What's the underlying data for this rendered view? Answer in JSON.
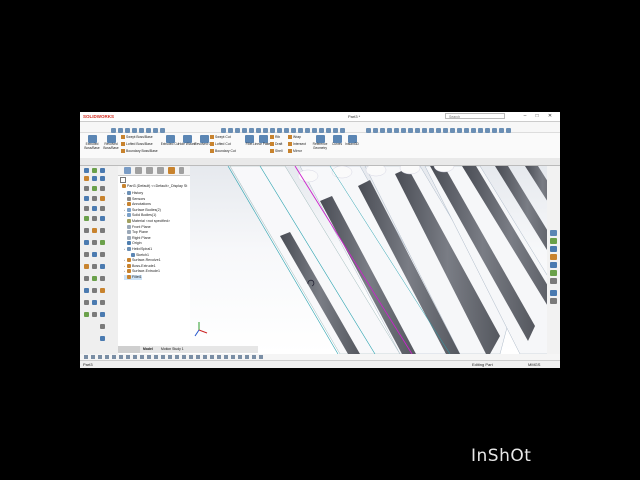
{
  "app": {
    "title": "Part3 *",
    "logo": "SOLIDWORKS",
    "search_placeholder": "Search"
  },
  "ribbon": {
    "big_buttons": [
      {
        "label": "Extruded Boss/Base"
      },
      {
        "label": "Revolved Boss/Base"
      },
      {
        "label": "Extruded Cut"
      },
      {
        "label": "Hole Wizard"
      },
      {
        "label": "Revolved Cut"
      },
      {
        "label": "Fillet"
      },
      {
        "label": "Linear Pattern"
      },
      {
        "label": "Reference Geometry"
      },
      {
        "label": "Curves"
      },
      {
        "label": "Instant3D"
      }
    ],
    "small_buttons": [
      {
        "label": "Swept Boss/Base"
      },
      {
        "label": "Lofted Boss/Base"
      },
      {
        "label": "Boundary Boss/Base"
      },
      {
        "label": "Swept Cut"
      },
      {
        "label": "Lofted Cut"
      },
      {
        "label": "Boundary Cut"
      },
      {
        "label": "Rib"
      },
      {
        "label": "Draft"
      },
      {
        "label": "Shell"
      },
      {
        "label": "Wrap"
      },
      {
        "label": "Intersect"
      },
      {
        "label": "Mirror"
      }
    ]
  },
  "tabs": [
    "Features",
    "Sketch",
    "Surfaces",
    "Sheet Metal",
    "Structure System",
    "Weld Tools",
    "Mesh Modeling",
    "Direct Editing",
    "Evaluate",
    "MBD Dimensions",
    "SOLIDWORKS Add-Ins"
  ],
  "feature_tree": {
    "root": "Part3 (Default) <<Default>_Display St",
    "items": [
      {
        "label": "History",
        "indent": 1,
        "expander": true,
        "color": "#6b8fb5"
      },
      {
        "label": "Sensors",
        "indent": 1,
        "expander": false,
        "color": "#8a8a8a"
      },
      {
        "label": "Annotations",
        "indent": 1,
        "expander": true,
        "color": "#c8832e"
      },
      {
        "label": "Surface Bodies(2)",
        "indent": 1,
        "expander": true,
        "color": "#7aa0c8"
      },
      {
        "label": "Solid Bodies(1)",
        "indent": 1,
        "expander": true,
        "color": "#7aa0c8"
      },
      {
        "label": "Material <not specified>",
        "indent": 1,
        "expander": false,
        "color": "#a0a060"
      },
      {
        "label": "Front Plane",
        "indent": 1,
        "expander": false,
        "color": "#9aa8b8"
      },
      {
        "label": "Top Plane",
        "indent": 1,
        "expander": false,
        "color": "#9aa8b8"
      },
      {
        "label": "Right Plane",
        "indent": 1,
        "expander": false,
        "color": "#9aa8b8"
      },
      {
        "label": "Origin",
        "indent": 1,
        "expander": false,
        "color": "#4f7fb0"
      },
      {
        "label": "Helix/Spiral1",
        "indent": 1,
        "expander": true,
        "color": "#6b8fb5"
      },
      {
        "label": "Sketch1",
        "indent": 2,
        "expander": false,
        "color": "#5b86b4"
      },
      {
        "label": "Surface-Revolve1",
        "indent": 1,
        "expander": true,
        "color": "#c8832e"
      },
      {
        "label": "Boss-Extrude1",
        "indent": 1,
        "expander": true,
        "color": "#c8832e"
      },
      {
        "label": "Surface-Extrude1",
        "indent": 1,
        "expander": true,
        "color": "#c8832e"
      },
      {
        "label": "Fillet1",
        "indent": 1,
        "expander": false,
        "color": "#c8832e",
        "selected": true
      }
    ]
  },
  "bottom_tabs": [
    "Model",
    "Motion Study 1"
  ],
  "status": {
    "left": "Part3",
    "mode": "Editing Part",
    "units": "MMGS"
  },
  "watermark": "InShOt"
}
